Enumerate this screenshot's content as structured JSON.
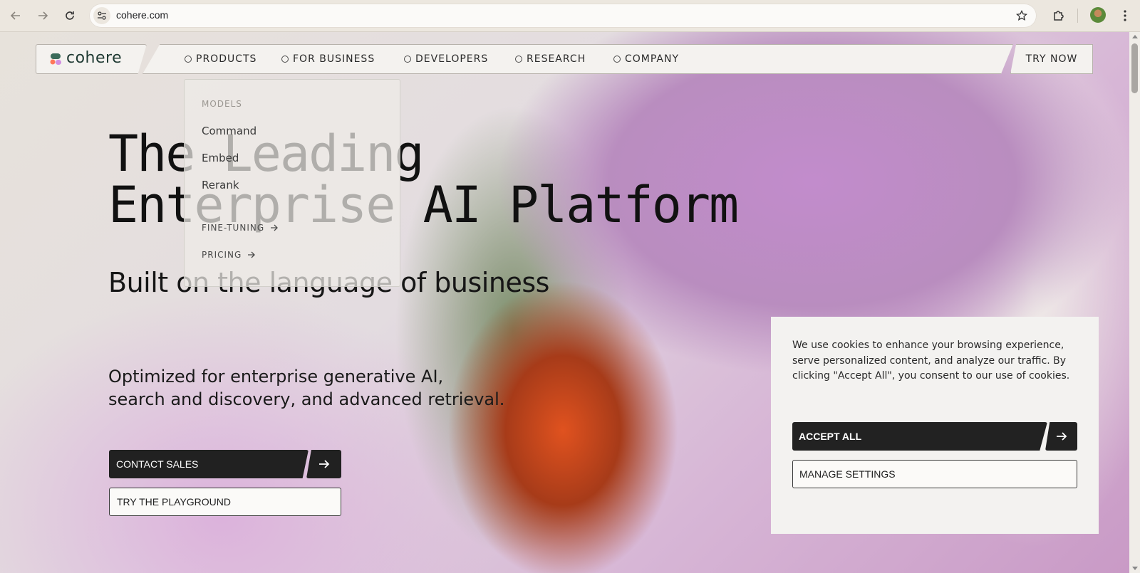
{
  "browser": {
    "url": "cohere.com"
  },
  "site": {
    "logo_text": "cohere",
    "nav": [
      {
        "label": "PRODUCTS"
      },
      {
        "label": "FOR BUSINESS"
      },
      {
        "label": "DEVELOPERS"
      },
      {
        "label": "RESEARCH"
      },
      {
        "label": "COMPANY"
      }
    ],
    "try_now": "TRY NOW"
  },
  "dropdown": {
    "heading": "MODELS",
    "items": [
      "Command",
      "Embed",
      "Rerank"
    ],
    "links": [
      "FINE-TUNING",
      "PRICING"
    ]
  },
  "hero": {
    "title_line1": "The Leading",
    "title_line2": "Enterprise AI Platform",
    "subtitle": "Built on the language of business",
    "desc_line1": "Optimized for enterprise generative AI,",
    "desc_line2": "search and discovery, and advanced retrieval.",
    "contact_sales": "CONTACT SALES",
    "try_playground": "TRY THE PLAYGROUND"
  },
  "cookie": {
    "text": "We use cookies to enhance your browsing experience, serve personalized content, and analyze our traffic. By clicking \"Accept All\", you consent to our use of cookies.",
    "accept": "ACCEPT ALL",
    "manage": "MANAGE SETTINGS"
  }
}
